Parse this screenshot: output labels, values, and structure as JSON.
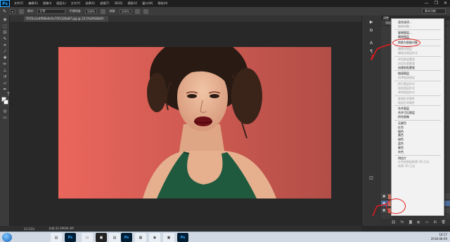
{
  "app": {
    "logo": "Ps",
    "menu": [
      "文件(F)",
      "编辑(E)",
      "图像(I)",
      "图层(L)",
      "文字(Y)",
      "选择(S)",
      "滤镜(T)",
      "3D(D)",
      "视图(V)",
      "窗口(W)",
      "帮助(H)"
    ],
    "window_controls": [
      "—",
      "❐",
      "✕"
    ]
  },
  "options_bar": {
    "mode_label": "模式:",
    "mode_value": "正常",
    "opacity_label": "不透明度:",
    "opacity_value": "100%",
    "flow_label": "流量:",
    "flow_value": "100%",
    "workspace": "基本功能"
  },
  "document": {
    "tab_title": "f5f25e1e4f0f8e6e5e75f1328a87.jpg @ 23.5%(RGB/8#)"
  },
  "status_bar": {
    "zoom": "23.53%",
    "doc_size": "文档:42.2M/84.4M"
  },
  "right_panel": {
    "header": "调整",
    "subheader": "添加调整",
    "layers": [
      {
        "label": "图层 1",
        "selected": false
      },
      {
        "label": "图层 1",
        "selected": true
      },
      {
        "label": "背景",
        "selected": false
      }
    ],
    "footer_icons": [
      "link-icon",
      "fx-icon",
      "mask-icon",
      "adjust-icon",
      "folder-icon",
      "new-layer-icon",
      "trash-icon"
    ]
  },
  "context_menu": {
    "items": [
      {
        "label": "混合选项...",
        "enabled": true
      },
      {
        "label": "编辑调整...",
        "enabled": false
      },
      {
        "sep": true
      },
      {
        "label": "复制图层...",
        "enabled": true
      },
      {
        "label": "删除图层",
        "enabled": true
      },
      {
        "sep": true
      },
      {
        "label": "转换为智能对象",
        "enabled": true
      },
      {
        "sep": true
      },
      {
        "label": "栅格化图层",
        "enabled": false
      },
      {
        "label": "栅格化图层样式",
        "enabled": false
      },
      {
        "sep": true
      },
      {
        "label": "停用图层蒙版",
        "enabled": false
      },
      {
        "label": "启用矢量蒙版",
        "enabled": false
      },
      {
        "label": "创建剪贴蒙版",
        "enabled": true
      },
      {
        "sep": true
      },
      {
        "label": "链接图层",
        "enabled": true
      },
      {
        "label": "选择链接图层",
        "enabled": false
      },
      {
        "sep": true
      },
      {
        "label": "拷贝图层样式",
        "enabled": false
      },
      {
        "label": "粘贴图层样式",
        "enabled": false
      },
      {
        "label": "清除图层样式",
        "enabled": false
      },
      {
        "sep": true
      },
      {
        "label": "复制形状属性",
        "enabled": false
      },
      {
        "label": "粘贴形状属性",
        "enabled": false
      },
      {
        "sep": true
      },
      {
        "label": "合并图层",
        "enabled": true
      },
      {
        "label": "合并可见图层",
        "enabled": true
      },
      {
        "label": "拼合图像",
        "enabled": true
      },
      {
        "sep": true
      },
      {
        "label": "无颜色",
        "enabled": true
      },
      {
        "label": "红色",
        "enabled": true
      },
      {
        "label": "橙色",
        "enabled": true
      },
      {
        "label": "黄色",
        "enabled": true
      },
      {
        "label": "绿色",
        "enabled": true
      },
      {
        "label": "蓝色",
        "enabled": true
      },
      {
        "label": "紫色",
        "enabled": true
      },
      {
        "label": "灰色",
        "enabled": true
      },
      {
        "sep": true
      },
      {
        "label": "明信片",
        "enabled": true
      },
      {
        "label": "从所选图层新建 3D 凸出",
        "enabled": false
      },
      {
        "label": "新建 3D 凸出",
        "enabled": false
      }
    ]
  },
  "taskbar": {
    "apps": [
      "Ps",
      "Ps",
      "Ps"
    ],
    "time": "18:17",
    "date": "2018-08-09"
  },
  "colors": {
    "photo_bg": "#e35f55",
    "highlight_red": "#e31b1b",
    "selected_layer": "#4e6d9a"
  }
}
